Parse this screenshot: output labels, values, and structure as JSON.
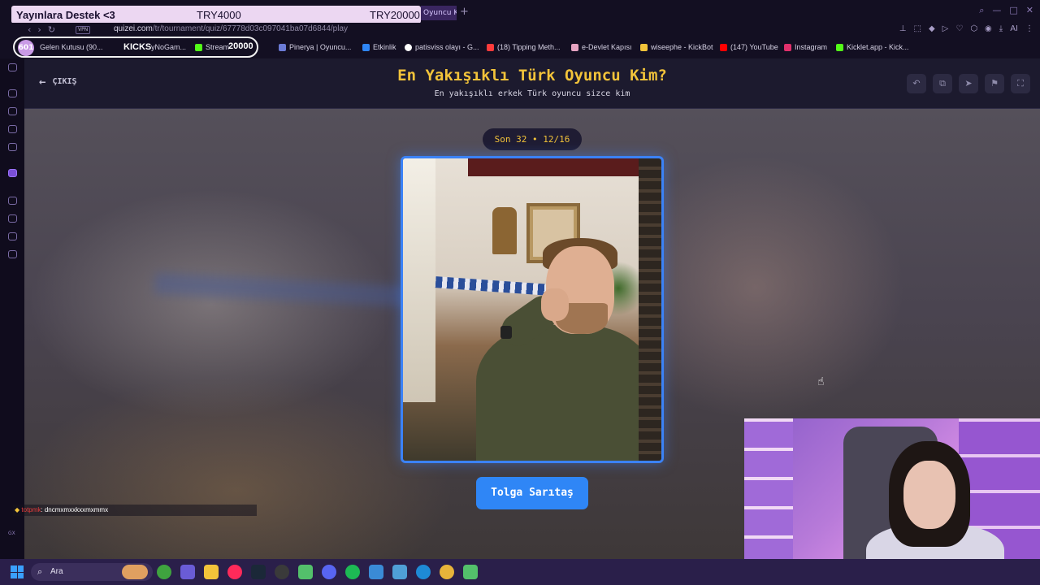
{
  "overlay": {
    "support_text": "Yayınlara Destek <3",
    "goal_current": "TRY4000",
    "goal_target": "TRY20000",
    "counter": "601",
    "kicks_label": "KICKS",
    "kicks_goal": "20000"
  },
  "browser": {
    "active_tab": "Oyuncu K",
    "new_tab": "+",
    "vpn": "VPN",
    "url_domain": "quizei.com",
    "url_path": "/tr/tournament/quiz/67778d03c097041ba07d6844/play",
    "addr_extra": "AI",
    "bookmarks": [
      {
        "label": "Gelen Kutusu (90...",
        "color": "#d14b4b"
      },
      {
        "label": "yNoGam...",
        "color": "#f2c33a"
      },
      {
        "label": "Stream",
        "color": "#53fc18"
      },
      {
        "label": "Pinerya | Oyuncu...",
        "color": "#6b7bd6"
      },
      {
        "label": "Etkinlik",
        "color": "#2f86f6"
      },
      {
        "label": "patisviss olayı - G...",
        "color": "#ffffff"
      },
      {
        "label": "(18) Tipping Meth...",
        "color": "#ff3b3b"
      },
      {
        "label": "e-Devlet Kapısı",
        "color": "#e6a3c2"
      },
      {
        "label": "wiseephe - KickBot",
        "color": "#f2c33a"
      },
      {
        "label": "(147) YouTube",
        "color": "#ff0000"
      },
      {
        "label": "Instagram",
        "color": "#e1306c"
      },
      {
        "label": "Kicklet.app - Kick...",
        "color": "#53fc18"
      }
    ]
  },
  "app": {
    "exit_label": "ÇIKIŞ",
    "title": "En Yakışıklı Türk Oyuncu Kim?",
    "subtitle": "En yakışıklı erkek Türk oyuncu sizce kim",
    "round": "Son 32 • 12/16",
    "candidate_name": "Tolga Sarıtaş"
  },
  "chat": {
    "username": "totpmk",
    "message": ": dncmxmxxkxxmxmmx"
  },
  "sidebar": {
    "gx": "GX"
  },
  "taskbar": {
    "search": "Ara"
  }
}
